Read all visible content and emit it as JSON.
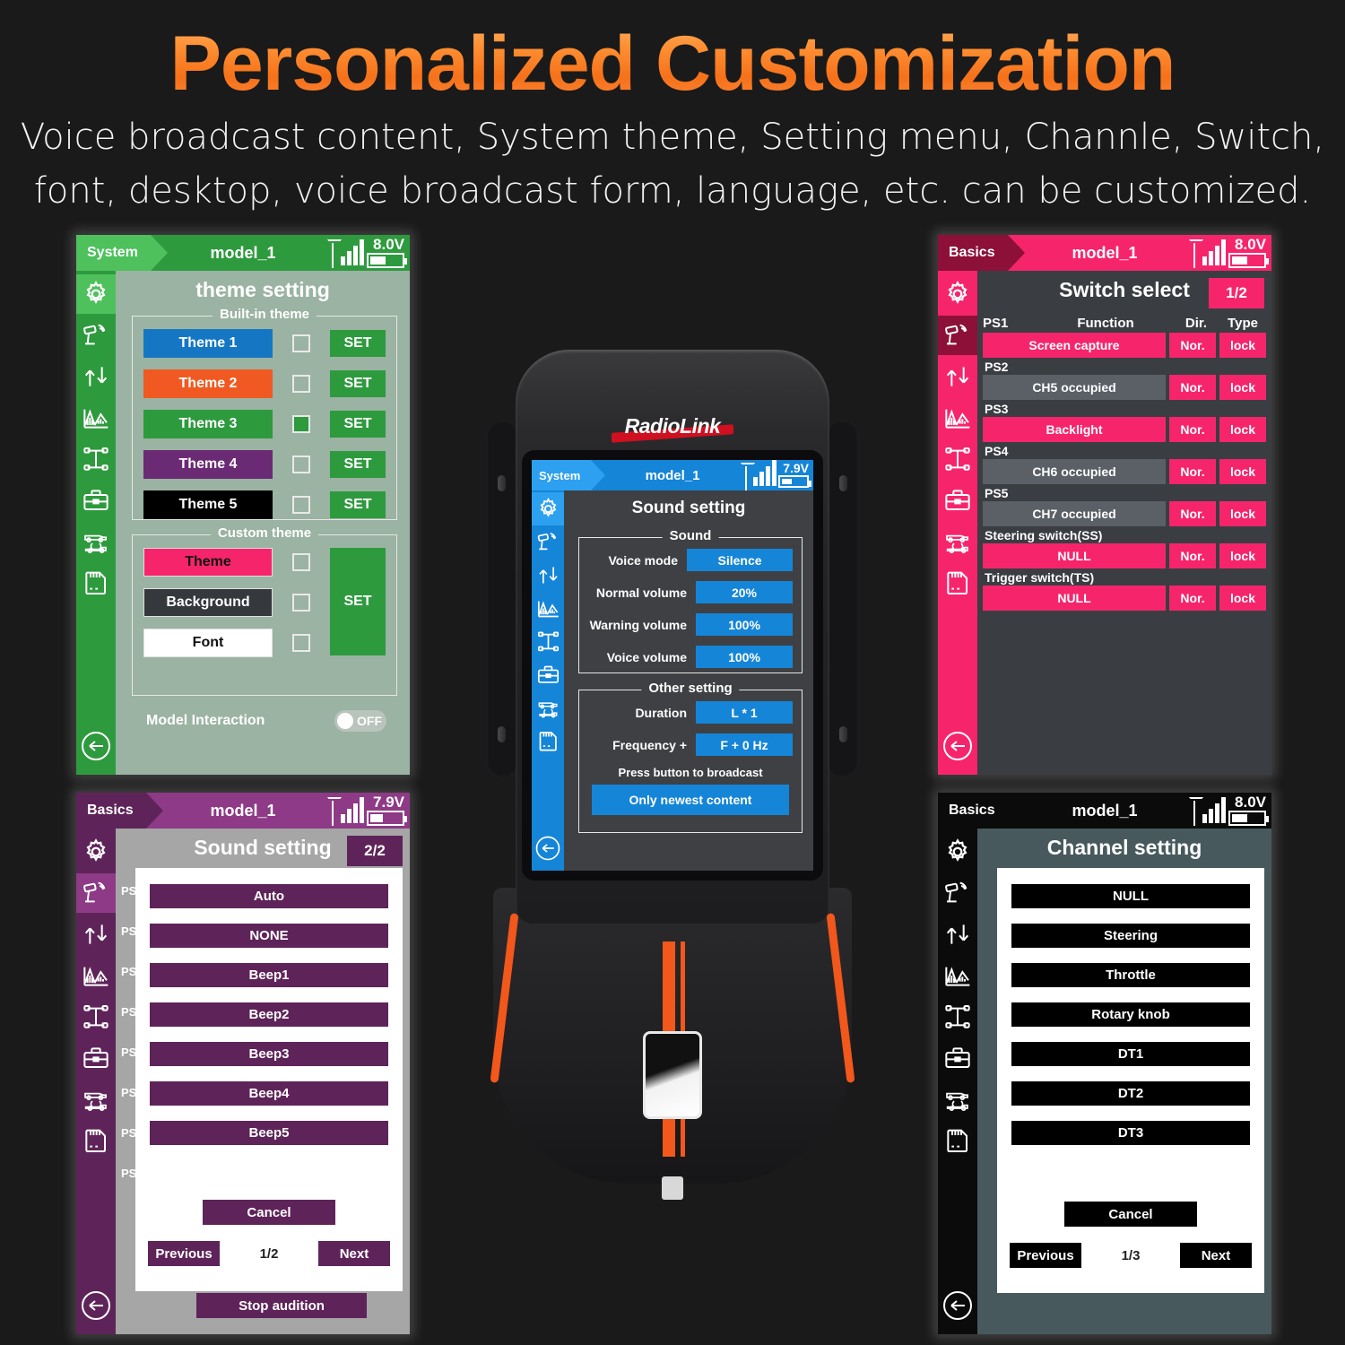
{
  "header": {
    "title": "Personalized Customization",
    "subtitle_line1": "Voice broadcast content, System theme, Setting menu, Channle, Switch,",
    "subtitle_line2": "font, desktop, voice broadcast form, language, etc. can be customized."
  },
  "device": {
    "brand": "RadioLink"
  },
  "theme_panel": {
    "topbar": {
      "tag": "System",
      "model": "model_1",
      "voltage": "8.0V"
    },
    "title": "theme setting",
    "builtin_group_label": "Built-in theme",
    "builtin_themes": [
      {
        "label": "Theme 1",
        "color": "#1577c4",
        "text_color": "#ffffff",
        "checked": false,
        "set_label": "SET"
      },
      {
        "label": "Theme 2",
        "color": "#f05a22",
        "text_color": "#ffffff",
        "checked": false,
        "set_label": "SET"
      },
      {
        "label": "Theme 3",
        "color": "#2e9a3e",
        "text_color": "#ffffff",
        "checked": true,
        "set_label": "SET"
      },
      {
        "label": "Theme 4",
        "color": "#6b2a74",
        "text_color": "#ffffff",
        "checked": false,
        "set_label": "SET"
      },
      {
        "label": "Theme 5",
        "color": "#000000",
        "text_color": "#ffffff",
        "checked": false,
        "set_label": "SET"
      }
    ],
    "custom_group_label": "Custom theme",
    "custom_items": [
      {
        "label": "Theme",
        "color": "#f6256b",
        "text_color": "#111111",
        "checked": false
      },
      {
        "label": "Background",
        "color": "#35383d",
        "text_color": "#ffffff",
        "checked": false
      },
      {
        "label": "Font",
        "color": "#ffffff",
        "text_color": "#111111",
        "checked": false
      }
    ],
    "custom_set_label": "SET",
    "model_interaction_label": "Model Interaction",
    "model_interaction_value": "OFF"
  },
  "switch_panel": {
    "topbar": {
      "tag": "Basics",
      "model": "model_1",
      "voltage": "8.0V"
    },
    "title": "Switch select",
    "page_badge": "1/2",
    "col_headers": {
      "ps": "PS1",
      "function": "Function",
      "dir": "Dir.",
      "type": "Type"
    },
    "rows": [
      {
        "name": "PS1",
        "function": "Screen capture",
        "dir": "Nor.",
        "type": "lock",
        "occupied": false,
        "header_row": true
      },
      {
        "name": "PS2",
        "function": "CH5 occupied",
        "dir": "Nor.",
        "type": "lock",
        "occupied": true,
        "header_row": false
      },
      {
        "name": "PS3",
        "function": "Backlight",
        "dir": "Nor.",
        "type": "lock",
        "occupied": false,
        "header_row": false
      },
      {
        "name": "PS4",
        "function": "CH6 occupied",
        "dir": "Nor.",
        "type": "lock",
        "occupied": true,
        "header_row": false
      },
      {
        "name": "PS5",
        "function": "CH7 occupied",
        "dir": "Nor.",
        "type": "lock",
        "occupied": true,
        "header_row": false
      },
      {
        "name": "Steering switch(SS)",
        "function": "NULL",
        "dir": "Nor.",
        "type": "lock",
        "occupied": false,
        "header_row": false
      },
      {
        "name": "Trigger switch(TS)",
        "function": "NULL",
        "dir": "Nor.",
        "type": "lock",
        "occupied": false,
        "header_row": false
      }
    ]
  },
  "sound_panel": {
    "topbar": {
      "tag": "Basics",
      "model": "model_1",
      "voltage": "7.9V"
    },
    "title": "Sound setting",
    "page_badge": "2/2",
    "options": [
      "Auto",
      "NONE",
      "Beep1",
      "Beep2",
      "Beep3",
      "Beep4",
      "Beep5"
    ],
    "cancel_label": "Cancel",
    "previous_label": "Previous",
    "page_indicator": "1/2",
    "next_label": "Next",
    "stop_audition_label": "Stop audition"
  },
  "channel_panel": {
    "topbar": {
      "tag": "Basics",
      "model": "model_1",
      "voltage": "8.0V"
    },
    "title": "Channel setting",
    "options": [
      "NULL",
      "Steering",
      "Throttle",
      "Rotary knob",
      "DT1",
      "DT2",
      "DT3"
    ],
    "cancel_label": "Cancel",
    "previous_label": "Previous",
    "page_indicator": "1/3",
    "next_label": "Next"
  },
  "device_screen": {
    "topbar": {
      "tag": "System",
      "model": "model_1",
      "voltage": "7.9V"
    },
    "title": "Sound setting",
    "sound_group_label": "Sound",
    "sound_rows": [
      {
        "label": "Voice mode",
        "value": "Silence"
      },
      {
        "label": "Normal volume",
        "value": "20%"
      },
      {
        "label": "Warning volume",
        "value": "100%"
      },
      {
        "label": "Voice volume",
        "value": "100%"
      }
    ],
    "other_group_label": "Other setting",
    "other_rows": [
      {
        "label": "Duration",
        "value": "L * 1"
      },
      {
        "label": "Frequency +",
        "value": "F + 0 Hz"
      }
    ],
    "broadcast_label": "Press button to broadcast",
    "broadcast_value": "Only newest content"
  },
  "sidebar_icons": [
    "gear-icon",
    "transmitter-icon",
    "updown-arrows-icon",
    "chart-icon",
    "chassis-icon",
    "toolbox-icon",
    "cars-icon",
    "sdcard-icon"
  ],
  "colors": {
    "accent_orange": "#f2571c",
    "green": "#2e9a3e",
    "pink": "#f6256b",
    "purple": "#5e2459",
    "blue": "#1585d8"
  }
}
